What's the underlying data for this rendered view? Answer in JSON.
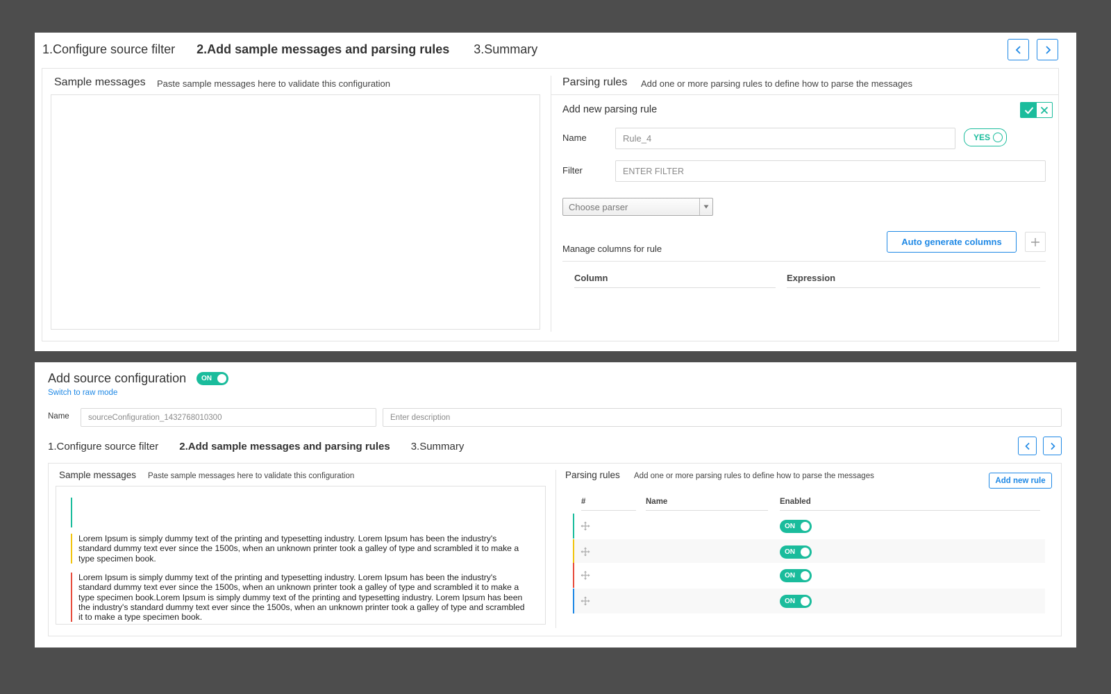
{
  "wizard_steps": [
    {
      "label": "1.Configure source filter",
      "active": false
    },
    {
      "label": "2.Add sample messages and parsing rules",
      "active": true
    },
    {
      "label": "3.Summary",
      "active": false
    }
  ],
  "panel1": {
    "sample": {
      "title": "Sample messages",
      "description": "Paste sample messages here to validate this configuration"
    },
    "parsing": {
      "title": "Parsing rules",
      "description": "Add one or more parsing rules to define how to parse the messages"
    },
    "new_rule": {
      "title": "Add new parsing rule",
      "name_label": "Name",
      "name_value": "Rule_4",
      "enabled_toggle": "YES",
      "filter_label": "Filter",
      "filter_placeholder": "ENTER FILTER",
      "parser_placeholder": "Choose parser",
      "manage_columns_label": "Manage columns for rule",
      "auto_generate_label": "Auto generate columns",
      "columns": [
        "Column",
        "Expression"
      ]
    }
  },
  "panel2": {
    "title": "Add source configuration",
    "title_toggle": "ON",
    "raw_mode_link": "Switch to raw mode",
    "name_label": "Name",
    "name_value": "sourceConfiguration_1432768010300",
    "description_placeholder": "Enter description",
    "sample": {
      "title": "Sample messages",
      "description": "Paste sample messages here to validate this configuration",
      "messages": [
        {
          "text": "",
          "color": "#1abc9c"
        },
        {
          "text": "Lorem Ipsum is simply dummy text of the printing and typesetting industry. Lorem Ipsum has been the industry's standard dummy text ever since the 1500s, when an unknown printer took a galley of type and scrambled it to make a type specimen book.",
          "color": "#f1c40f"
        },
        {
          "text": "Lorem Ipsum is simply dummy text of the printing and typesetting industry. Lorem Ipsum has been the industry's standard dummy text ever since the 1500s, when an unknown printer took a galley of type and scrambled it to make a type specimen book.Lorem Ipsum is simply dummy text of the printing and typesetting industry. Lorem Ipsum has been the industry's standard dummy text ever since the 1500s, when an unknown printer took a galley of type and scrambled it to make a type specimen book.",
          "color": "#e74c3c"
        }
      ]
    },
    "parsing": {
      "title": "Parsing rules",
      "description": "Add one or more parsing rules to define how to parse the messages",
      "add_rule_label": "Add new rule",
      "columns": [
        "#",
        "Name",
        "Enabled"
      ],
      "rules": [
        {
          "name": "",
          "enabled": "ON",
          "color": "#1abc9c"
        },
        {
          "name": "",
          "enabled": "ON",
          "color": "#f1c40f"
        },
        {
          "name": "",
          "enabled": "ON",
          "color": "#e74c3c"
        },
        {
          "name": "",
          "enabled": "ON",
          "color": "#1e88e5"
        }
      ]
    }
  },
  "colors": {
    "accent": "#1abc9c",
    "link": "#1e88e5",
    "background": "#4d4d4d"
  },
  "icons": {
    "prev": "chevron-left-icon",
    "next": "chevron-right-icon",
    "confirm": "check-icon",
    "cancel": "close-icon",
    "add": "plus-icon",
    "drag": "move-icon",
    "dropdown": "caret-down-icon"
  }
}
